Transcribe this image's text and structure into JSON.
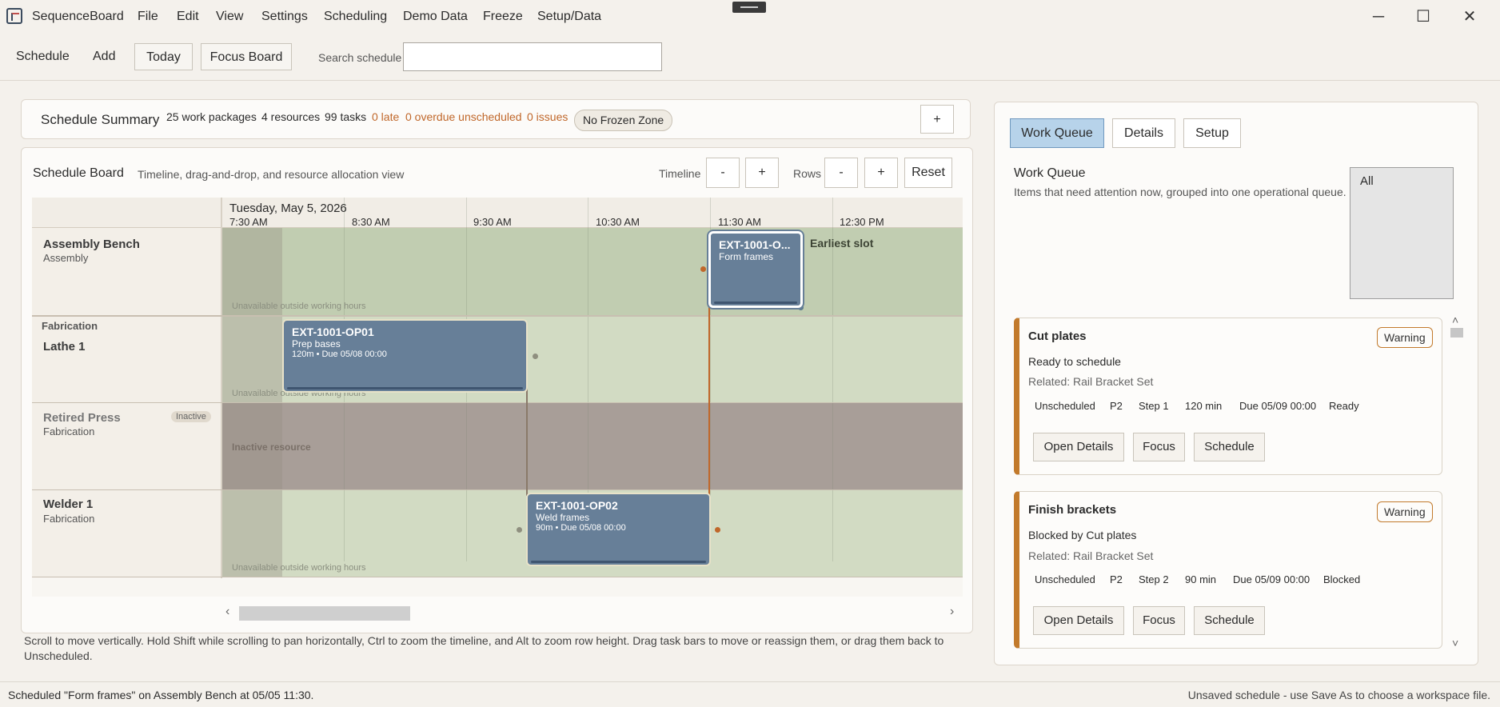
{
  "window": {
    "app_name": "SequenceBoard",
    "minimize": "─",
    "maximize": "☐",
    "close": "✕"
  },
  "menu": [
    "File",
    "Edit",
    "View",
    "Settings",
    "Scheduling",
    "Demo Data",
    "Freeze",
    "Setup/Data"
  ],
  "toolbar": {
    "schedule": "Schedule",
    "add": "Add",
    "today": "Today",
    "focus_board": "Focus Board",
    "search_label": "Search schedule",
    "search_value": ""
  },
  "summary": {
    "title": "Schedule Summary",
    "work_packages": "25 work packages",
    "resources": "4 resources",
    "tasks": "99 tasks",
    "late": "0 late",
    "overdue": "0 overdue unscheduled",
    "issues": "0 issues",
    "frozen": "No Frozen Zone",
    "add": "+"
  },
  "board": {
    "title": "Schedule Board",
    "subtitle": "Timeline, drag-and-drop, and resource allocation view",
    "timeline_label": "Timeline",
    "rows_label": "Rows",
    "minus": "-",
    "plus": "+",
    "reset": "Reset",
    "date": "Tuesday, May 5, 2026",
    "times": [
      "7:30 AM",
      "8:30 AM",
      "9:30 AM",
      "10:30 AM",
      "11:30 AM",
      "12:30 PM"
    ],
    "resources": [
      {
        "group": "",
        "name": "Assembly Bench",
        "sub": "Assembly",
        "note": "Unavailable outside working hours"
      },
      {
        "group": "Fabrication",
        "name": "Lathe 1",
        "sub": "",
        "note": "Unavailable outside working hours"
      },
      {
        "group": "",
        "name": "Retired Press",
        "sub": "Fabrication",
        "badge": "Inactive",
        "note": "Inactive resource"
      },
      {
        "group": "",
        "name": "Welder 1",
        "sub": "Fabrication",
        "note": "Unavailable outside working hours"
      }
    ],
    "tasks": [
      {
        "code": "EXT-1001-O...",
        "name": "Form frames",
        "meta": ""
      },
      {
        "code": "EXT-1001-OP01",
        "name": "Prep bases",
        "meta": "120m • Due 05/08 00:00"
      },
      {
        "code": "EXT-1001-OP02",
        "name": "Weld frames",
        "meta": "90m • Due 05/08 00:00"
      }
    ],
    "earliest_slot": "Earliest slot",
    "scroll_left": "‹",
    "scroll_right": "›",
    "help": "Scroll to move vertically. Hold Shift while scrolling to pan horizontally, Ctrl to zoom the timeline, and Alt to zoom row height. Drag task bars to move or reassign them, or drag them back to",
    "help2": "Unscheduled."
  },
  "right": {
    "tabs": [
      "Work Queue",
      "Details",
      "Setup"
    ],
    "title": "Work Queue",
    "subtitle": "Items that need attention now, grouped into one operational queue.",
    "filter": "All",
    "cards": [
      {
        "title": "Cut plates",
        "badge": "Warning",
        "status": "Ready to schedule",
        "related": "Related: Rail Bracket Set",
        "meta": [
          "Unscheduled",
          "P2",
          "Step 1",
          "120 min",
          "Due 05/09 00:00",
          "Ready"
        ],
        "buttons": [
          "Open Details",
          "Focus",
          "Schedule"
        ]
      },
      {
        "title": "Finish brackets",
        "badge": "Warning",
        "status": "Blocked by Cut plates",
        "related": "Related: Rail Bracket Set",
        "meta": [
          "Unscheduled",
          "P2",
          "Step 2",
          "90 min",
          "Due 05/09 00:00",
          "Blocked"
        ],
        "buttons": [
          "Open Details",
          "Focus",
          "Schedule"
        ]
      }
    ],
    "scroll_up": "˄",
    "scroll_down": "˅"
  },
  "status": {
    "left": "Scheduled \"Form frames\" on Assembly Bench at 05/05 11:30.",
    "right": "Unsaved schedule - use Save As to choose a workspace file."
  },
  "colors": {
    "accent": "#b7d3ea",
    "task": "#677f98",
    "warning": "#c27a2c",
    "late": "#c0672a",
    "row_available": "#d2dbc3",
    "row_inactive": "#a89e98"
  }
}
